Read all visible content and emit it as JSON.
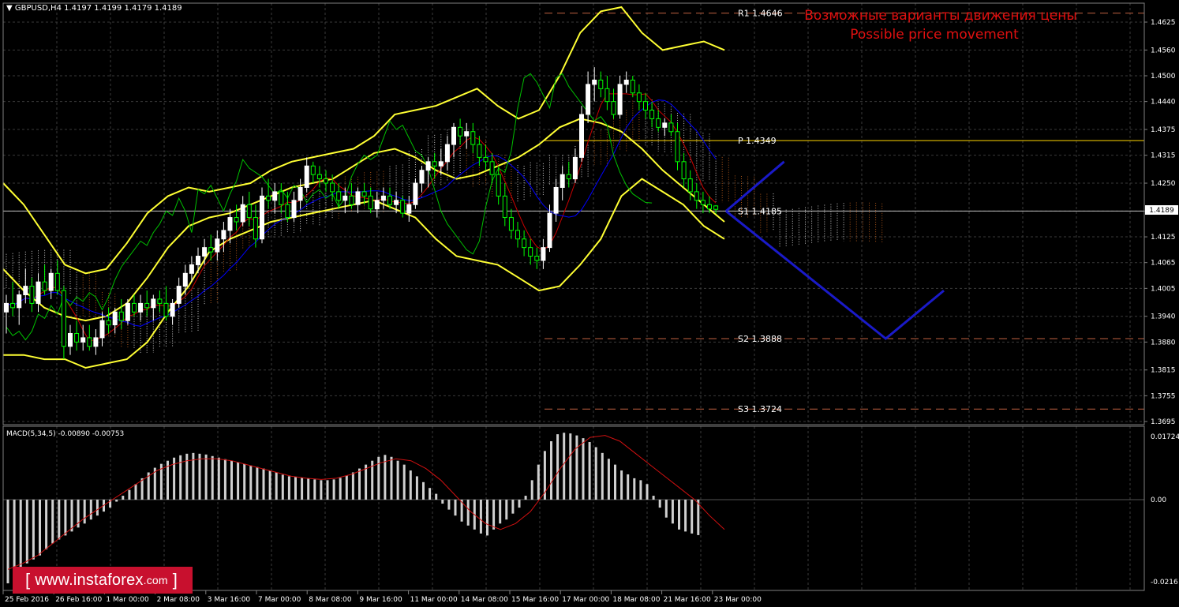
{
  "header": {
    "symbol_info": "GBPUSD,H4  1.4197 1.4199 1.4179 1.4189",
    "title_ru": "Возможные варианты движения цены",
    "title_en": "Possible price movement"
  },
  "watermark": {
    "bracket_open": "[",
    "site": "www.instaforex",
    "domain": ".com",
    "bracket_close": "]"
  },
  "colors": {
    "background": "#000000",
    "grid": "#3a3a3a",
    "bull": "#ffffff",
    "bear": "#00ff00",
    "bollinger": "#ffff33",
    "tenkan": "#cc0000",
    "kijun": "#0000ff",
    "chikou": "#00c000",
    "cloud_a": "#ffffff",
    "cloud_b": "#d2691e",
    "forecast": "#1a1ac8",
    "level_solid": "#ffd700",
    "level_dashed": "#c06040",
    "title_text": "#e01010",
    "macd_hist": "#d0d0d0",
    "macd_signal": "#d01010",
    "watermark_bg": "#c8102e"
  },
  "chart_data": [
    {
      "type": "candlestick",
      "symbol": "GBPUSD",
      "timeframe": "H4",
      "current_price": 1.4189,
      "current_price_label": "1.4189",
      "ylim": [
        1.3695,
        1.4675
      ],
      "y_ticks": [
        "1.4625",
        "1.4560",
        "1.4500",
        "1.4440",
        "1.4375",
        "1.4315",
        "1.4250",
        "1.4185",
        "1.4125",
        "1.4065",
        "1.4005",
        "1.3940",
        "1.3880",
        "1.3815",
        "1.3755",
        "1.3695"
      ],
      "x_ticks": [
        "25 Feb 2016",
        "26 Feb 16:00",
        "1 Mar 00:00",
        "2 Mar 08:00",
        "3 Mar 16:00",
        "7 Mar 00:00",
        "8 Mar 08:00",
        "9 Mar 16:00",
        "11 Mar 00:00",
        "14 Mar 08:00",
        "15 Mar 16:00",
        "17 Mar 00:00",
        "18 Mar 08:00",
        "21 Mar 16:00",
        "23 Mar 00:00"
      ],
      "levels": [
        {
          "name": "R1",
          "label": "R1  1.4646",
          "value": 1.4646,
          "style": "dashed"
        },
        {
          "name": "P",
          "label": "P  1.4349",
          "value": 1.4349,
          "style": "solid"
        },
        {
          "name": "S1",
          "label": "S1  1.4185",
          "value": 1.4185,
          "style": "solid"
        },
        {
          "name": "S2",
          "label": "S2  1.3888",
          "value": 1.3888,
          "style": "dashed"
        },
        {
          "name": "S3",
          "label": "S3  1.3724",
          "value": 1.3724,
          "style": "dashed"
        }
      ],
      "candles": [
        [
          1.395,
          1.399,
          1.39,
          1.397
        ],
        [
          1.397,
          1.402,
          1.394,
          1.396
        ],
        [
          1.396,
          1.4,
          1.392,
          1.399
        ],
        [
          1.399,
          1.405,
          1.397,
          1.401
        ],
        [
          1.401,
          1.403,
          1.395,
          1.397
        ],
        [
          1.397,
          1.404,
          1.395,
          1.402
        ],
        [
          1.402,
          1.406,
          1.399,
          1.4
        ],
        [
          1.4,
          1.405,
          1.398,
          1.404
        ],
        [
          1.404,
          1.407,
          1.399,
          1.4
        ],
        [
          1.4,
          1.401,
          1.384,
          1.387
        ],
        [
          1.387,
          1.392,
          1.385,
          1.39
        ],
        [
          1.39,
          1.393,
          1.386,
          1.388
        ],
        [
          1.388,
          1.392,
          1.386,
          1.389
        ],
        [
          1.389,
          1.392,
          1.386,
          1.387
        ],
        [
          1.387,
          1.391,
          1.385,
          1.389
        ],
        [
          1.389,
          1.395,
          1.387,
          1.393
        ],
        [
          1.393,
          1.396,
          1.39,
          1.392
        ],
        [
          1.392,
          1.396,
          1.39,
          1.395
        ],
        [
          1.395,
          1.398,
          1.391,
          1.393
        ],
        [
          1.393,
          1.398,
          1.392,
          1.397
        ],
        [
          1.397,
          1.399,
          1.394,
          1.395
        ],
        [
          1.395,
          1.399,
          1.393,
          1.397
        ],
        [
          1.397,
          1.4,
          1.394,
          1.396
        ],
        [
          1.396,
          1.399,
          1.393,
          1.398
        ],
        [
          1.398,
          1.4,
          1.395,
          1.397
        ],
        [
          1.397,
          1.401,
          1.393,
          1.394
        ],
        [
          1.394,
          1.398,
          1.392,
          1.397
        ],
        [
          1.397,
          1.403,
          1.396,
          1.401
        ],
        [
          1.401,
          1.406,
          1.399,
          1.404
        ],
        [
          1.404,
          1.408,
          1.402,
          1.406
        ],
        [
          1.406,
          1.41,
          1.404,
          1.408
        ],
        [
          1.408,
          1.412,
          1.406,
          1.41
        ],
        [
          1.41,
          1.413,
          1.407,
          1.409
        ],
        [
          1.409,
          1.414,
          1.407,
          1.412
        ],
        [
          1.412,
          1.416,
          1.409,
          1.414
        ],
        [
          1.414,
          1.419,
          1.411,
          1.417
        ],
        [
          1.417,
          1.42,
          1.414,
          1.416
        ],
        [
          1.416,
          1.422,
          1.415,
          1.42
        ],
        [
          1.42,
          1.423,
          1.415,
          1.417
        ],
        [
          1.417,
          1.42,
          1.41,
          1.412
        ],
        [
          1.412,
          1.424,
          1.411,
          1.422
        ],
        [
          1.422,
          1.426,
          1.419,
          1.421
        ],
        [
          1.421,
          1.425,
          1.418,
          1.423
        ],
        [
          1.423,
          1.425,
          1.418,
          1.42
        ],
        [
          1.42,
          1.423,
          1.416,
          1.417
        ],
        [
          1.417,
          1.423,
          1.416,
          1.421
        ],
        [
          1.421,
          1.426,
          1.419,
          1.424
        ],
        [
          1.424,
          1.431,
          1.423,
          1.429
        ],
        [
          1.429,
          1.43,
          1.425,
          1.427
        ],
        [
          1.427,
          1.429,
          1.424,
          1.426
        ],
        [
          1.426,
          1.428,
          1.423,
          1.425
        ],
        [
          1.425,
          1.427,
          1.421,
          1.423
        ],
        [
          1.423,
          1.425,
          1.419,
          1.421
        ],
        [
          1.421,
          1.424,
          1.418,
          1.422
        ],
        [
          1.422,
          1.425,
          1.419,
          1.42
        ],
        [
          1.42,
          1.424,
          1.418,
          1.423
        ],
        [
          1.423,
          1.425,
          1.42,
          1.422
        ],
        [
          1.422,
          1.424,
          1.418,
          1.419
        ],
        [
          1.419,
          1.423,
          1.417,
          1.421
        ],
        [
          1.421,
          1.424,
          1.419,
          1.422
        ],
        [
          1.422,
          1.424,
          1.419,
          1.42
        ],
        [
          1.42,
          1.423,
          1.418,
          1.421
        ],
        [
          1.421,
          1.422,
          1.417,
          1.418
        ],
        [
          1.418,
          1.422,
          1.416,
          1.42
        ],
        [
          1.42,
          1.426,
          1.419,
          1.425
        ],
        [
          1.425,
          1.429,
          1.423,
          1.428
        ],
        [
          1.428,
          1.431,
          1.424,
          1.43
        ],
        [
          1.43,
          1.432,
          1.426,
          1.429
        ],
        [
          1.429,
          1.433,
          1.427,
          1.43
        ],
        [
          1.43,
          1.436,
          1.428,
          1.434
        ],
        [
          1.434,
          1.439,
          1.431,
          1.438
        ],
        [
          1.438,
          1.44,
          1.434,
          1.436
        ],
        [
          1.436,
          1.439,
          1.433,
          1.437
        ],
        [
          1.437,
          1.439,
          1.432,
          1.434
        ],
        [
          1.434,
          1.436,
          1.429,
          1.431
        ],
        [
          1.431,
          1.434,
          1.428,
          1.43
        ],
        [
          1.43,
          1.432,
          1.425,
          1.427
        ],
        [
          1.427,
          1.429,
          1.42,
          1.422
        ],
        [
          1.422,
          1.425,
          1.415,
          1.417
        ],
        [
          1.417,
          1.419,
          1.412,
          1.414
        ],
        [
          1.414,
          1.416,
          1.41,
          1.412
        ],
        [
          1.412,
          1.414,
          1.408,
          1.41
        ],
        [
          1.41,
          1.412,
          1.406,
          1.408
        ],
        [
          1.408,
          1.41,
          1.405,
          1.407
        ],
        [
          1.407,
          1.412,
          1.405,
          1.41
        ],
        [
          1.41,
          1.42,
          1.409,
          1.418
        ],
        [
          1.418,
          1.426,
          1.416,
          1.424
        ],
        [
          1.424,
          1.429,
          1.421,
          1.427
        ],
        [
          1.427,
          1.43,
          1.424,
          1.426
        ],
        [
          1.426,
          1.433,
          1.425,
          1.431
        ],
        [
          1.431,
          1.443,
          1.43,
          1.441
        ],
        [
          1.441,
          1.451,
          1.439,
          1.448
        ],
        [
          1.448,
          1.452,
          1.444,
          1.449
        ],
        [
          1.449,
          1.451,
          1.445,
          1.447
        ],
        [
          1.447,
          1.45,
          1.442,
          1.444
        ],
        [
          1.444,
          1.447,
          1.44,
          1.441
        ],
        [
          1.441,
          1.45,
          1.44,
          1.448
        ],
        [
          1.448,
          1.451,
          1.446,
          1.449
        ],
        [
          1.449,
          1.45,
          1.445,
          1.446
        ],
        [
          1.446,
          1.448,
          1.442,
          1.444
        ],
        [
          1.444,
          1.446,
          1.44,
          1.442
        ],
        [
          1.442,
          1.444,
          1.438,
          1.44
        ],
        [
          1.44,
          1.442,
          1.437,
          1.438
        ],
        [
          1.438,
          1.44,
          1.436,
          1.439
        ],
        [
          1.439,
          1.441,
          1.436,
          1.437
        ],
        [
          1.437,
          1.439,
          1.428,
          1.43
        ],
        [
          1.43,
          1.432,
          1.424,
          1.426
        ],
        [
          1.426,
          1.428,
          1.421,
          1.423
        ],
        [
          1.423,
          1.425,
          1.419,
          1.421
        ],
        [
          1.421,
          1.423,
          1.418,
          1.42
        ],
        [
          1.42,
          1.422,
          1.418,
          1.419
        ],
        [
          1.4197,
          1.4199,
          1.4179,
          1.4189
        ]
      ],
      "bollinger": {
        "upper": [
          1.425,
          1.42,
          1.413,
          1.406,
          1.404,
          1.405,
          1.411,
          1.418,
          1.422,
          1.424,
          1.423,
          1.424,
          1.425,
          1.428,
          1.43,
          1.431,
          1.432,
          1.433,
          1.436,
          1.441,
          1.442,
          1.443,
          1.445,
          1.447,
          1.443,
          1.44,
          1.442,
          1.45,
          1.46,
          1.465,
          1.466,
          1.46,
          1.456,
          1.457,
          1.458,
          1.456
        ],
        "middle": [
          1.405,
          1.4,
          1.396,
          1.394,
          1.393,
          1.394,
          1.397,
          1.403,
          1.41,
          1.415,
          1.417,
          1.418,
          1.42,
          1.422,
          1.424,
          1.425,
          1.426,
          1.429,
          1.432,
          1.433,
          1.431,
          1.428,
          1.426,
          1.427,
          1.429,
          1.431,
          1.434,
          1.438,
          1.44,
          1.439,
          1.437,
          1.433,
          1.428,
          1.424,
          1.42,
          1.416
        ],
        "lower": [
          1.385,
          1.385,
          1.384,
          1.384,
          1.382,
          1.383,
          1.384,
          1.388,
          1.395,
          1.401,
          1.409,
          1.412,
          1.414,
          1.416,
          1.417,
          1.418,
          1.419,
          1.42,
          1.421,
          1.419,
          1.417,
          1.412,
          1.408,
          1.407,
          1.406,
          1.403,
          1.4,
          1.401,
          1.406,
          1.412,
          1.422,
          1.426,
          1.423,
          1.42,
          1.415,
          1.412
        ]
      },
      "forecast": {
        "up_path": [
          [
            1.4185,
            0
          ],
          [
            1.43,
            8
          ]
        ],
        "down_path": [
          [
            1.4185,
            0
          ],
          [
            1.3888,
            22
          ],
          [
            1.4,
            30
          ]
        ]
      }
    },
    {
      "type": "bar",
      "name": "MACD(5,34,5)",
      "label": "MACD(5,34,5) -0.00890 -0.00753",
      "ylim": [
        -0.0216,
        0.01724
      ],
      "y_ticks": [
        "0.01724",
        "0.00",
        "-0.0216"
      ],
      "histogram": [
        -0.021,
        -0.019,
        -0.0175,
        -0.016,
        -0.015,
        -0.014,
        -0.0125,
        -0.011,
        -0.01,
        -0.009,
        -0.008,
        -0.007,
        -0.006,
        -0.005,
        -0.004,
        -0.003,
        -0.002,
        -0.0005,
        0.001,
        0.0025,
        0.004,
        0.0055,
        0.007,
        0.0082,
        0.0092,
        0.01,
        0.0108,
        0.0114,
        0.0118,
        0.012,
        0.0118,
        0.0116,
        0.0112,
        0.0108,
        0.0104,
        0.01,
        0.0096,
        0.0092,
        0.0088,
        0.0084,
        0.008,
        0.0074,
        0.007,
        0.0064,
        0.006,
        0.0058,
        0.0056,
        0.0054,
        0.0052,
        0.005,
        0.005,
        0.0052,
        0.0056,
        0.0062,
        0.007,
        0.008,
        0.009,
        0.01,
        0.011,
        0.0115,
        0.011,
        0.01,
        0.009,
        0.0075,
        0.006,
        0.0045,
        0.003,
        0.0015,
        -0.001,
        -0.0025,
        -0.004,
        -0.0055,
        -0.0065,
        -0.0075,
        -0.0085,
        -0.009,
        -0.0075,
        -0.006,
        -0.005,
        -0.0035,
        -0.002,
        0.001,
        0.005,
        0.009,
        0.0125,
        0.015,
        0.0168,
        0.0172,
        0.017,
        0.0165,
        0.0158,
        0.0148,
        0.0135,
        0.012,
        0.0105,
        0.009,
        0.0075,
        0.0065,
        0.0055,
        0.005,
        0.004,
        0.001,
        -0.002,
        -0.0045,
        -0.006,
        -0.0075,
        -0.008,
        -0.0085,
        -0.0089
      ],
      "signal": [
        -0.0175,
        -0.016,
        -0.014,
        -0.011,
        -0.008,
        -0.005,
        -0.0025,
        0.0,
        0.0025,
        0.005,
        0.0075,
        0.009,
        0.01,
        0.0105,
        0.0105,
        0.01,
        0.009,
        0.008,
        0.007,
        0.006,
        0.0055,
        0.0052,
        0.0055,
        0.0065,
        0.008,
        0.0095,
        0.0105,
        0.01,
        0.008,
        0.005,
        0.001,
        -0.003,
        -0.006,
        -0.0075,
        -0.006,
        -0.003,
        0.002,
        0.008,
        0.013,
        0.016,
        0.0165,
        0.015,
        0.012,
        0.009,
        0.006,
        0.003,
        0.0,
        -0.004,
        -0.0075
      ]
    }
  ]
}
